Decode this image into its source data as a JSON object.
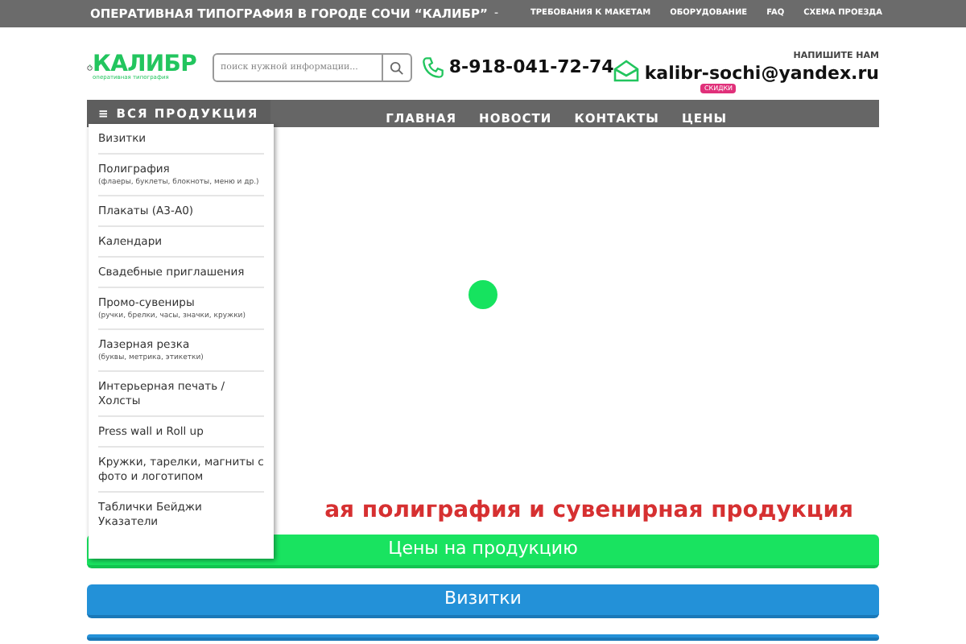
{
  "top_bar": {
    "title": "ОПЕРАТИВНАЯ ТИПОГРАФИЯ В ГОРОДЕ СОЧИ “КАЛИБР”",
    "separator": "-",
    "links": [
      "ТРЕБОВАНИЯ К МАКЕТАМ",
      "ОБОРУДОВАНИЕ",
      "FAQ",
      "СХЕМА ПРОЕЗДА"
    ]
  },
  "header": {
    "logo": {
      "name": "КАЛИБР",
      "tagline": "оперативная типография"
    },
    "search": {
      "placeholder": "поиск нужной информации..."
    },
    "phone": "8-918-041-72-74",
    "email_caption": "НАПИШИТЕ НАМ",
    "email": "kalibr-sochi@yandex.ru"
  },
  "nav": {
    "catalog": {
      "icon": "≡",
      "label": "ВСЯ ПРОДУКЦИЯ",
      "expanded": true
    },
    "links": [
      {
        "label": "ГЛАВНАЯ"
      },
      {
        "label": "НОВОСТИ"
      },
      {
        "label": "КОНТАКТЫ"
      },
      {
        "label": "ЦЕНЫ",
        "badge": "СКИДКИ"
      }
    ]
  },
  "catalog_menu": [
    {
      "label": "Визитки"
    },
    {
      "label": "Полиграфия",
      "note": "(флаеры, буклеты, блокноты, меню и др.)"
    },
    {
      "label": "Плакаты (А3-А0)"
    },
    {
      "label": "Календари"
    },
    {
      "label": "Свадебные приглашения"
    },
    {
      "label": "Промо-сувениры",
      "note": "(ручки, брелки, часы, значки, кружки)"
    },
    {
      "label": "Лазерная резка",
      "note": "(буквы, метрика, этикетки)"
    },
    {
      "label": "Интерьерная печать / Холсты"
    },
    {
      "label": "Press wall и Roll up"
    },
    {
      "label": "Кружки, тарелки, магниты с фото и логотипом"
    },
    {
      "label": "Таблички Бейджи Указатели"
    }
  ],
  "main": {
    "heading": "ая полиграфия и сувенирная продукция",
    "buttons": [
      {
        "label": "Цены на продукцию",
        "kind": "green"
      },
      {
        "label": "Визитки",
        "kind": "blue"
      },
      {
        "kind": "blue"
      }
    ]
  }
}
